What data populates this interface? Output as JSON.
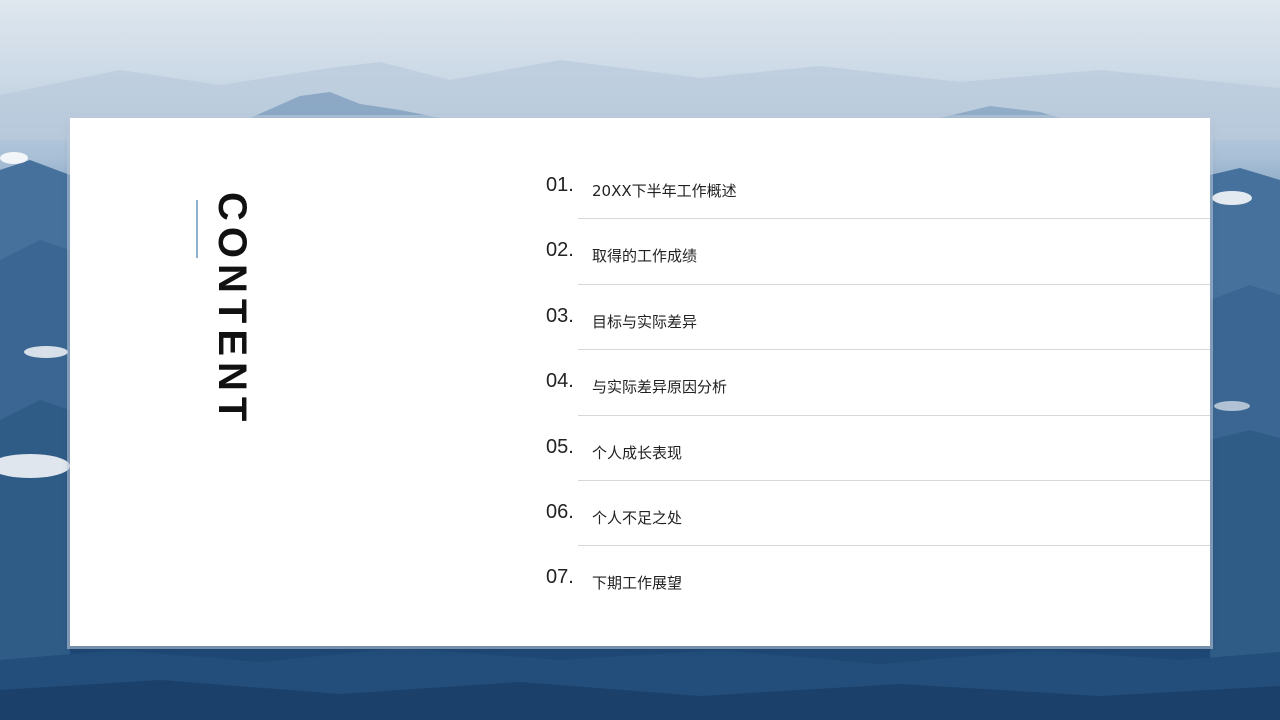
{
  "slide": {
    "title": "CONTENT",
    "accent_color": "#8fb0cf",
    "items": [
      {
        "number": "01.",
        "label": "20XX下半年工作概述"
      },
      {
        "number": "02.",
        "label": "取得的工作成绩"
      },
      {
        "number": "03.",
        "label": "目标与实际差异"
      },
      {
        "number": "04.",
        "label": "与实际差异原因分析"
      },
      {
        "number": "05.",
        "label": "个人成长表现"
      },
      {
        "number": "06.",
        "label": "个人不足之处"
      },
      {
        "number": "07.",
        "label": "下期工作展望"
      }
    ]
  }
}
